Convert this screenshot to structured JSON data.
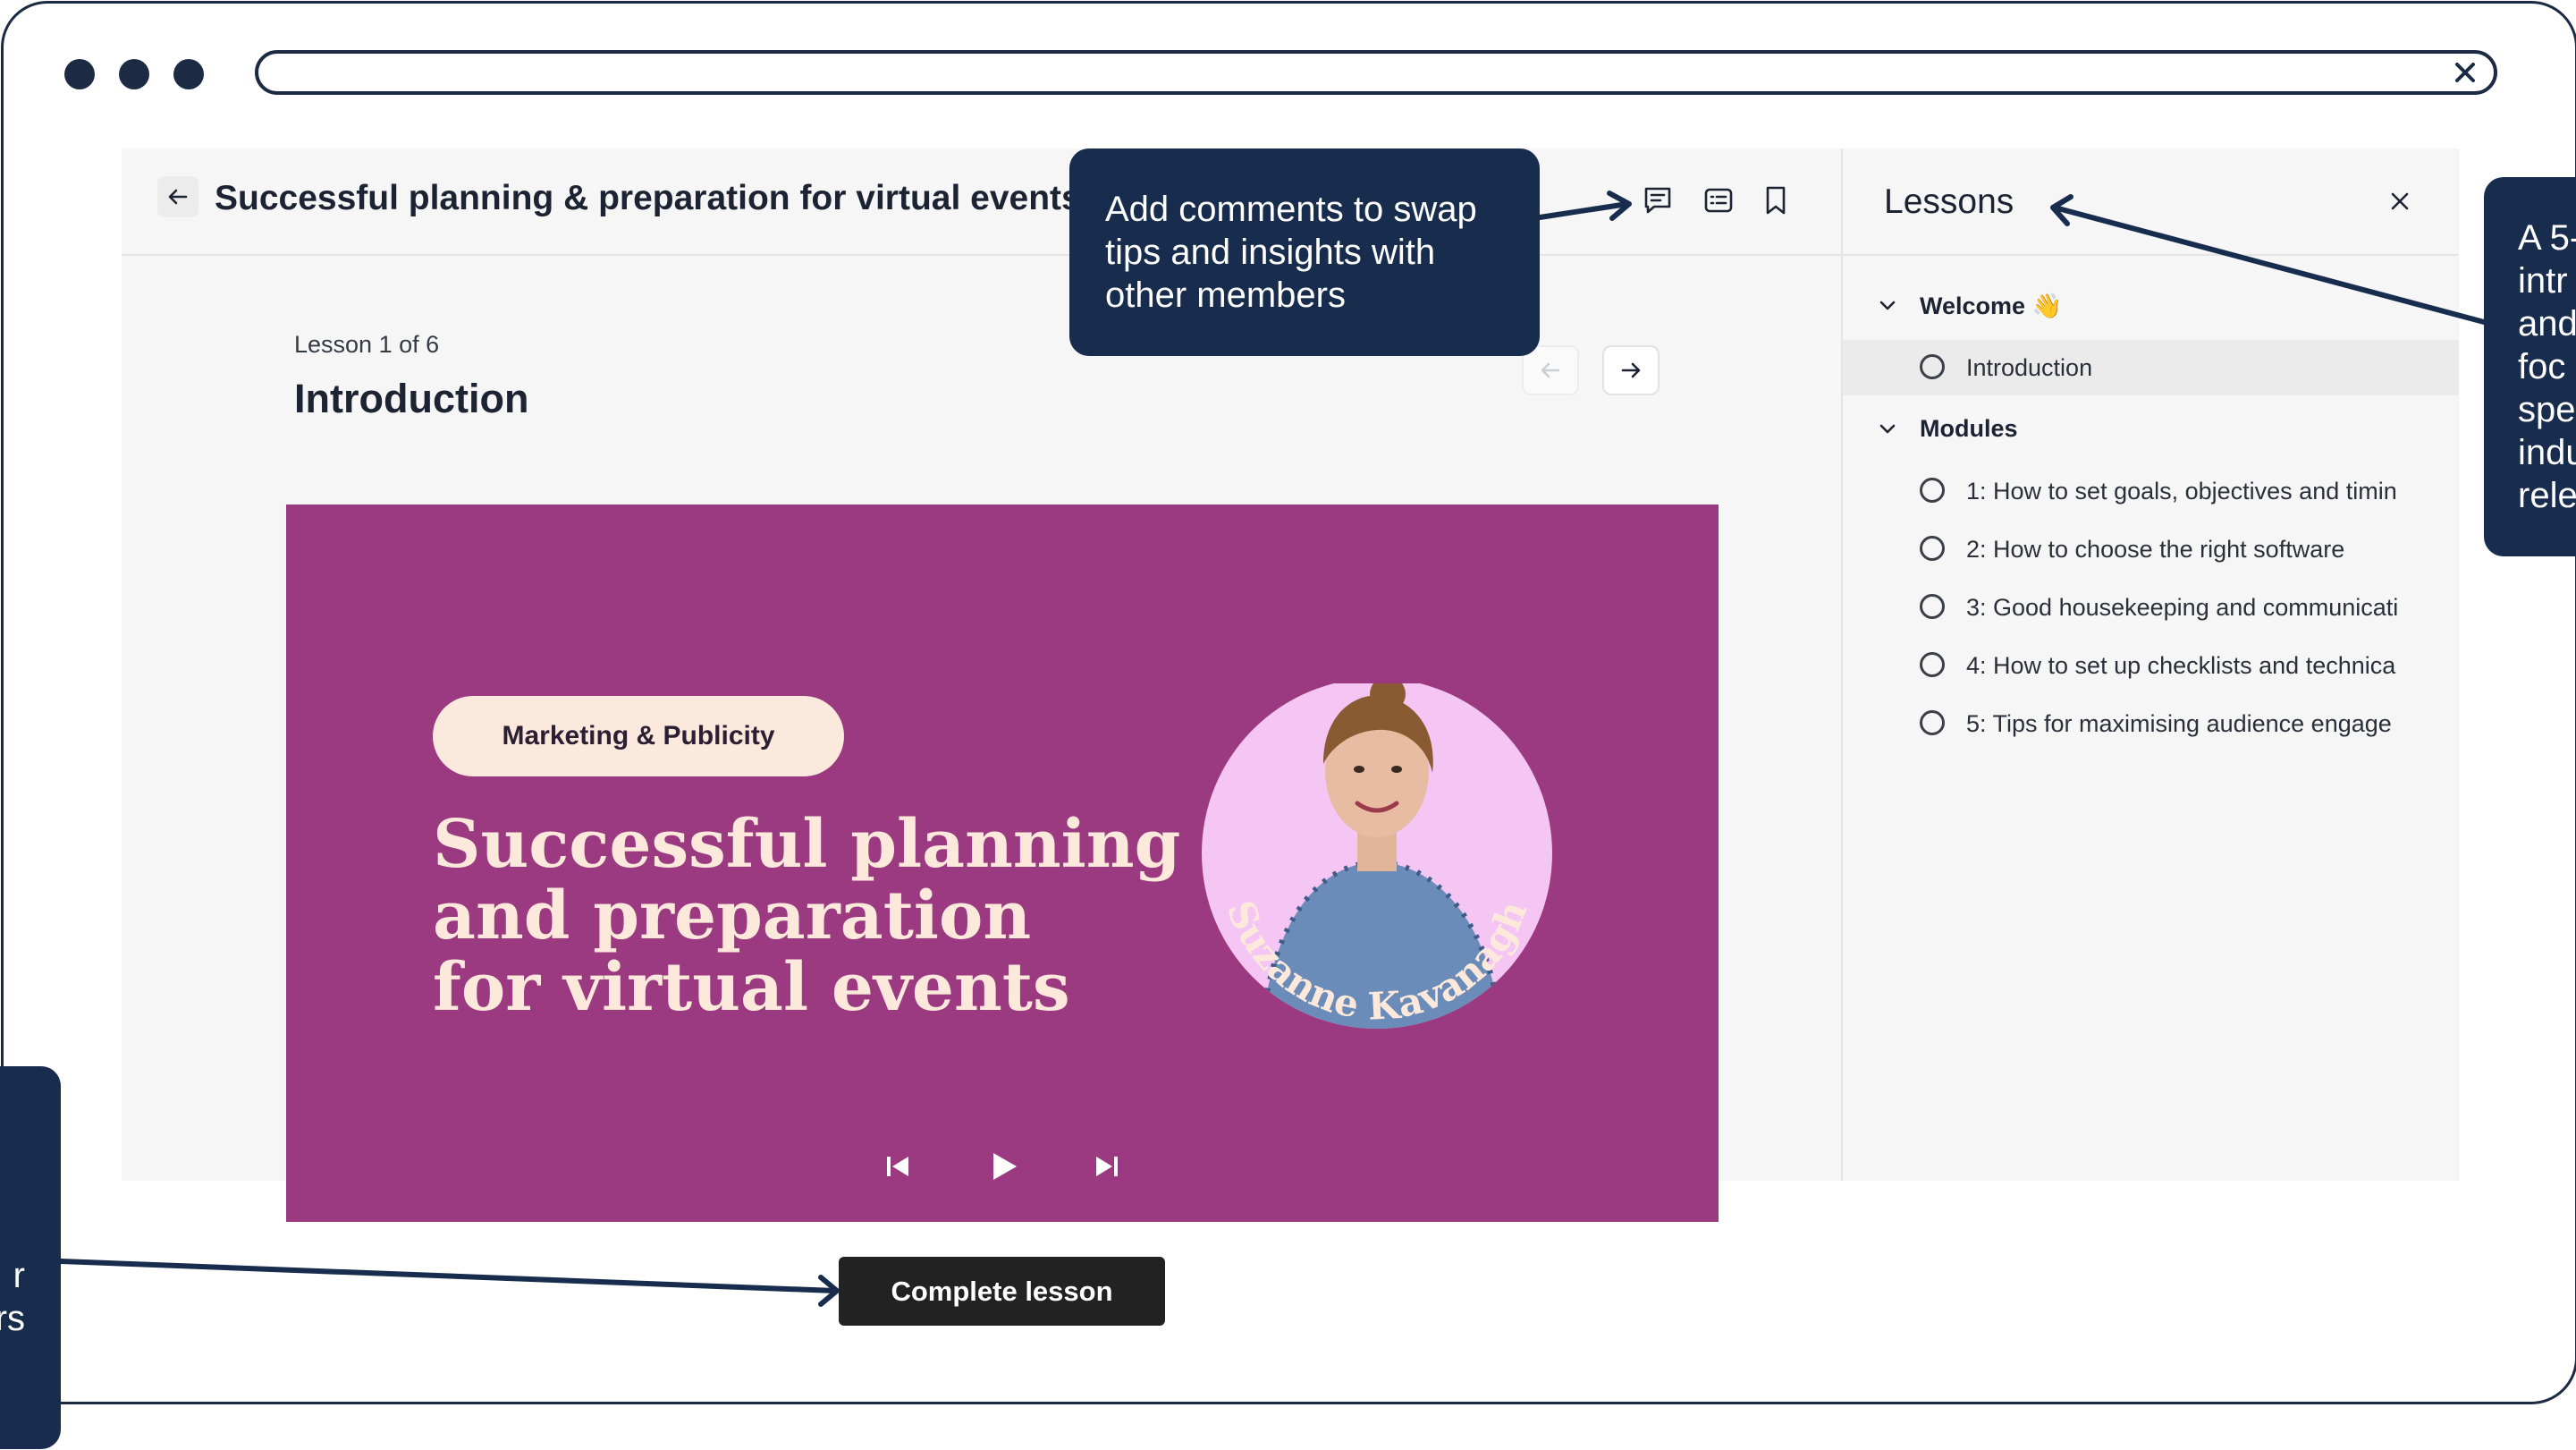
{
  "browser": {
    "window_dots": [
      "dot",
      "dot",
      "dot"
    ],
    "close_icon": "close-icon"
  },
  "header": {
    "back_icon": "arrow-left-icon",
    "course_title": "Successful planning & preparation for virtual events",
    "actions": [
      {
        "name": "comments-button",
        "icon": "comment-icon"
      },
      {
        "name": "notes-button",
        "icon": "notes-icon"
      },
      {
        "name": "bookmark-button",
        "icon": "bookmark-icon"
      }
    ]
  },
  "lesson": {
    "count": "Lesson 1 of 6",
    "title": "Introduction",
    "prev_icon": "arrow-left-icon",
    "next_icon": "arrow-right-icon"
  },
  "video": {
    "category": "Marketing & Publicity",
    "headline_lines": [
      "Successful planning",
      "and preparation",
      "for virtual events"
    ],
    "presenter": "Suzanne Kavanagh",
    "colors": {
      "background": "#9b3a80",
      "headline": "#fce9dc",
      "pill": "#fbe9dd",
      "photo_circle": "#f5c6f3"
    },
    "controls": [
      "skip-back-icon",
      "play-icon",
      "skip-forward-icon"
    ]
  },
  "complete_button": "Complete lesson",
  "lessons_panel": {
    "title": "Lessons",
    "sections": [
      {
        "label": "Welcome 👋",
        "items": [
          {
            "label": "Introduction",
            "active": true
          }
        ]
      },
      {
        "label": "Modules",
        "items": [
          {
            "label": "1: How to set goals, objectives and timin",
            "active": false
          },
          {
            "label": "2: How to choose the right software",
            "active": false
          },
          {
            "label": "3: Good housekeeping and communicati",
            "active": false
          },
          {
            "label": "4: How to set up checklists and technica",
            "active": false
          },
          {
            "label": "5: Tips for maximising audience engage",
            "active": false
          }
        ]
      }
    ]
  },
  "callouts": {
    "comments": "Add comments to swap tips and insights with other members",
    "right_lines": [
      "A 5-",
      "intr",
      "and",
      "foc",
      "spe",
      "indu",
      "rele"
    ],
    "left_lines": [
      "r",
      "rs"
    ]
  },
  "colors": {
    "callout": "#182d4d",
    "frame": "#1c2a44",
    "complete_button": "#222222"
  }
}
